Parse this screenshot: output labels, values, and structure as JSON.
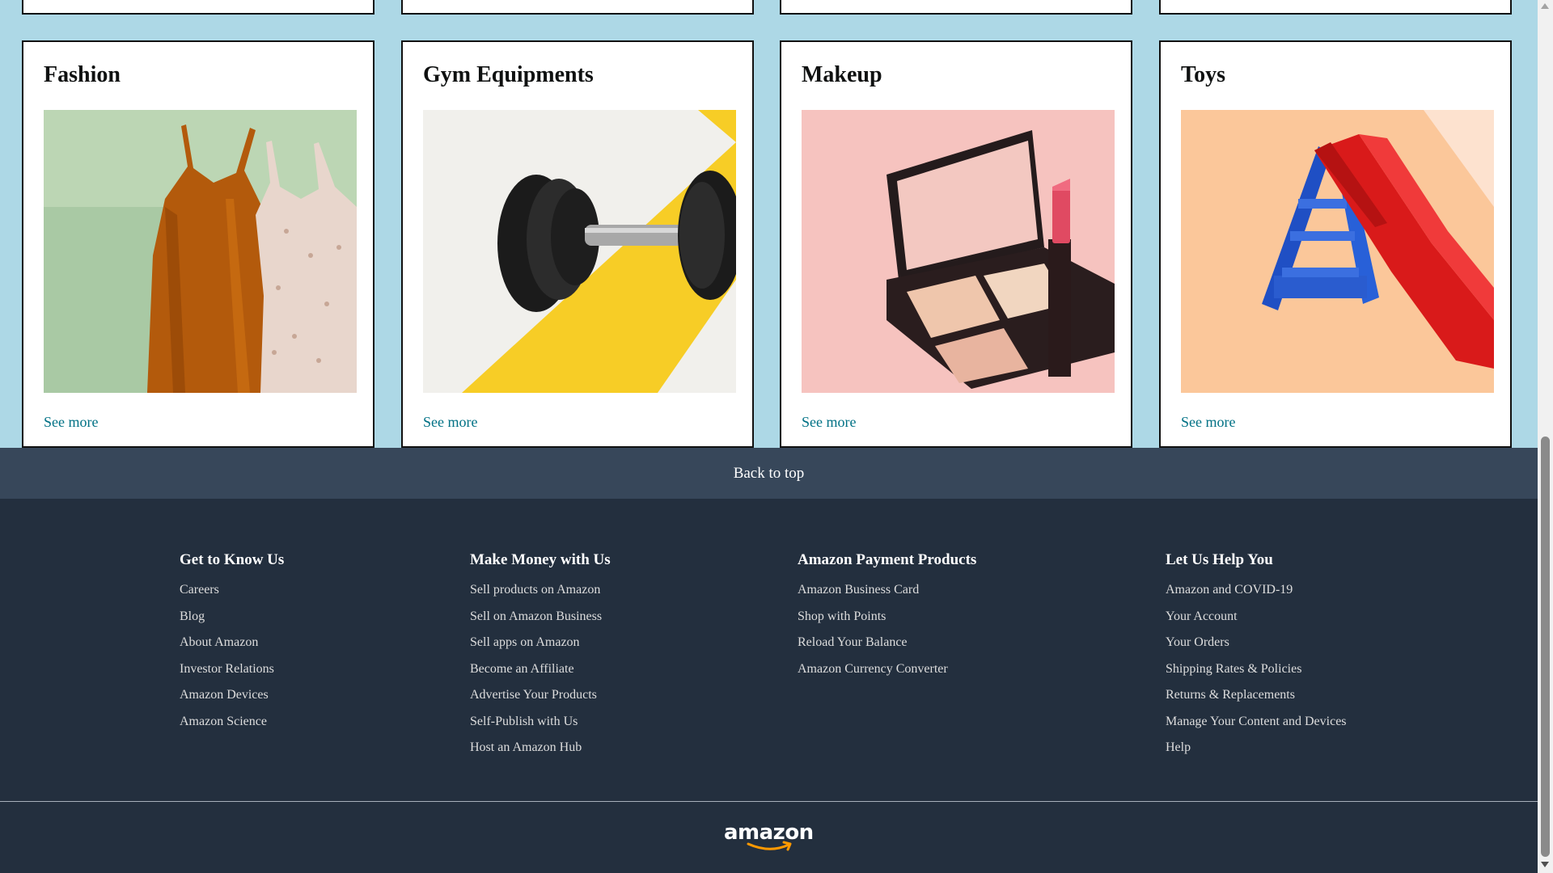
{
  "categories": [
    {
      "title": "Fashion",
      "link": "See more",
      "image": "fashion-dresses-image"
    },
    {
      "title": "Gym Equipments",
      "link": "See more",
      "image": "dumbbell-image"
    },
    {
      "title": "Makeup",
      "link": "See more",
      "image": "makeup-compact-image"
    },
    {
      "title": "Toys",
      "link": "See more",
      "image": "toy-slide-image"
    }
  ],
  "back_to_top": "Back to top",
  "footer": {
    "columns": [
      {
        "heading": "Get to Know Us",
        "links": [
          "Careers",
          "Blog",
          "About Amazon",
          "Investor Relations",
          "Amazon Devices",
          "Amazon Science"
        ]
      },
      {
        "heading": "Make Money with Us",
        "links": [
          "Sell products on Amazon",
          "Sell on Amazon Business",
          "Sell apps on Amazon",
          "Become an Affiliate",
          "Advertise Your Products",
          "Self-Publish with Us",
          "Host an Amazon Hub"
        ]
      },
      {
        "heading": "Amazon Payment Products",
        "links": [
          "Amazon Business Card",
          "Shop with Points",
          "Reload Your Balance",
          "Amazon Currency Converter"
        ]
      },
      {
        "heading": "Let Us Help You",
        "links": [
          "Amazon and COVID-19",
          "Your Account",
          "Your Orders",
          "Shipping Rates & Policies",
          "Returns & Replacements",
          "Manage Your Content and Devices",
          "Help"
        ]
      }
    ],
    "logo": "amazon"
  },
  "colors": {
    "page_background": "#add8e6",
    "back_to_top_bg": "#37475a",
    "footer_bg": "#232f3e",
    "link_color": "#007185",
    "logo_smile": "#f90"
  }
}
